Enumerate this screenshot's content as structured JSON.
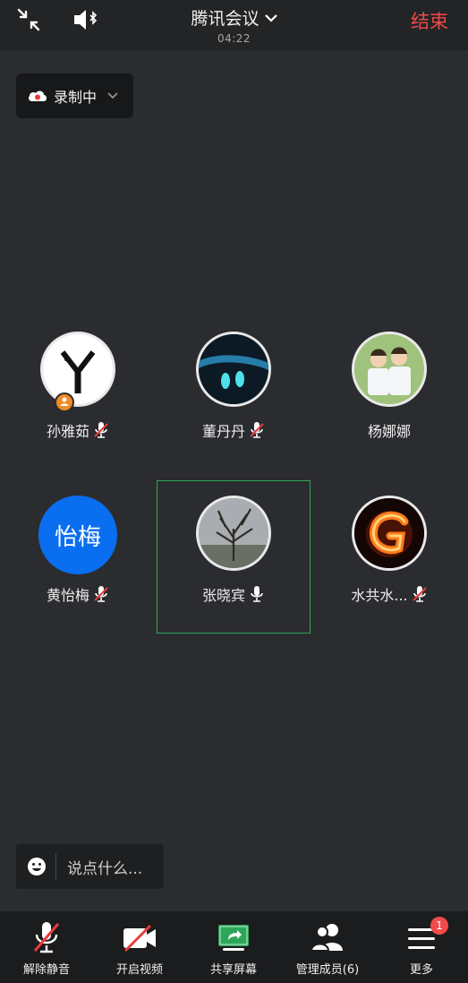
{
  "header": {
    "title": "腾讯会议",
    "timer": "04:22",
    "end_label": "结束",
    "icons": [
      "collapse-icon",
      "speaker-bluetooth-icon",
      "chevron-down-icon"
    ]
  },
  "recording": {
    "label": "录制中"
  },
  "participants": [
    {
      "name": "孙雅茹",
      "avatar_icon": "logo-y-avatar",
      "mic": "muted",
      "host": true
    },
    {
      "name": "董丹丹",
      "avatar_icon": "footprints-photo-avatar",
      "mic": "muted"
    },
    {
      "name": "杨娜娜",
      "avatar_icon": "kids-photo-avatar",
      "mic": "none"
    },
    {
      "name": "黄怡梅",
      "avatar_text": "怡梅",
      "mic": "muted"
    },
    {
      "name": "张晓宾",
      "avatar_icon": "tree-photo-avatar",
      "mic": "on",
      "active_speaker": true
    },
    {
      "name": "水共水...",
      "avatar_icon": "fire-letter-g-avatar",
      "mic": "muted"
    }
  ],
  "chat": {
    "placeholder": "说点什么..."
  },
  "toolbar": [
    {
      "label": "解除静音",
      "icon": "mic-muted-icon"
    },
    {
      "label": "开启视频",
      "icon": "camera-off-icon"
    },
    {
      "label": "共享屏幕",
      "icon": "share-screen-icon"
    },
    {
      "label": "管理成员(6)",
      "icon": "members-icon"
    },
    {
      "label": "更多",
      "icon": "menu-icon",
      "badge": "1"
    }
  ],
  "colors": {
    "end": "#ef4a4a",
    "speaker_frame": "#2ea65a",
    "share_icon": "#2ea65a",
    "avatar_blue": "#0a6ef0",
    "host_badge": "#f08a25",
    "badge": "#f24a4a"
  }
}
